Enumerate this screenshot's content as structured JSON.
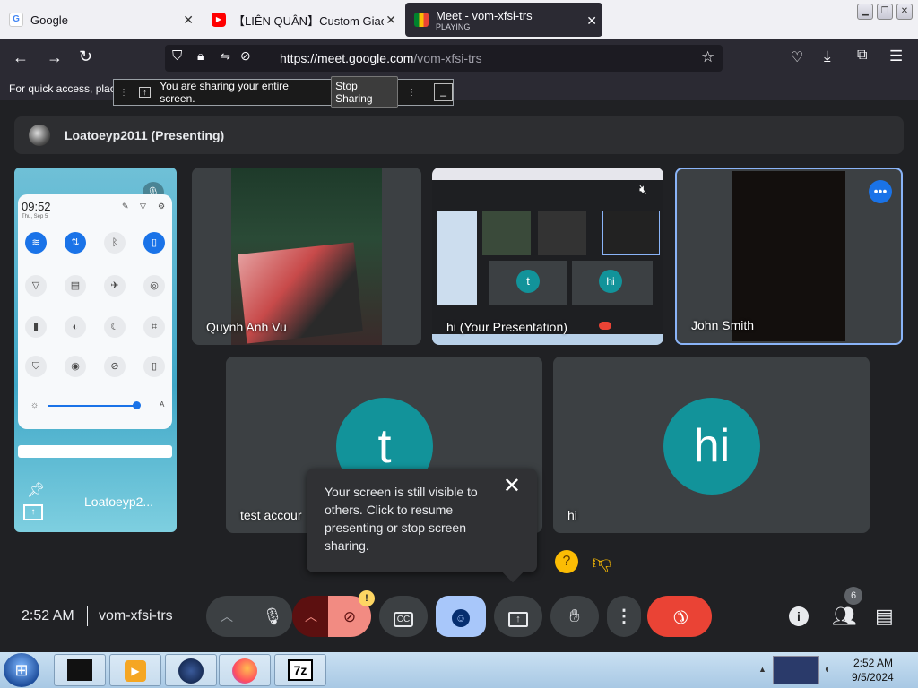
{
  "browser": {
    "tabs": [
      {
        "label": "Google",
        "icon": "google-icon"
      },
      {
        "label": "【LIÊN QUÂN】Custom Giao H",
        "icon": "youtube-icon"
      },
      {
        "label": "Meet - vom-xfsi-trs",
        "sublabel": "PLAYING",
        "icon": "meet-icon"
      }
    ],
    "url_prefix": "https://meet.google.com",
    "url_path": "/vom-xfsi-trs",
    "bookmark_hint": "For quick access, plac"
  },
  "share_notice": {
    "text": "You are sharing your entire screen.",
    "stop_label": "Stop Sharing"
  },
  "meet": {
    "presenter_banner": "Loatoeyp2011 (Presenting)",
    "tiles": [
      {
        "name": "Loatoeyp2..."
      },
      {
        "name": "Quynh Anh Vu"
      },
      {
        "name": "hi (Your Presentation)"
      },
      {
        "name": "John Smith"
      },
      {
        "name": "test accour",
        "initial": "t"
      },
      {
        "name": "hi",
        "initial": "hi"
      }
    ],
    "phone": {
      "time": "09:52",
      "date": "Thu, Sep 5"
    },
    "tooltip": "Your screen is still visible to others. Click to resume presenting or stop screen sharing.",
    "meeting_time": "2:52 AM",
    "meeting_code": "vom-xfsi-trs",
    "people_count": "6",
    "cc_label": "CC"
  },
  "taskbar": {
    "time": "2:52 AM",
    "date": "9/5/2024",
    "zip_label": "7z"
  },
  "colors": {
    "accent": "#8ab4f8",
    "end_call": "#ea4335",
    "teal": "#12939a"
  }
}
